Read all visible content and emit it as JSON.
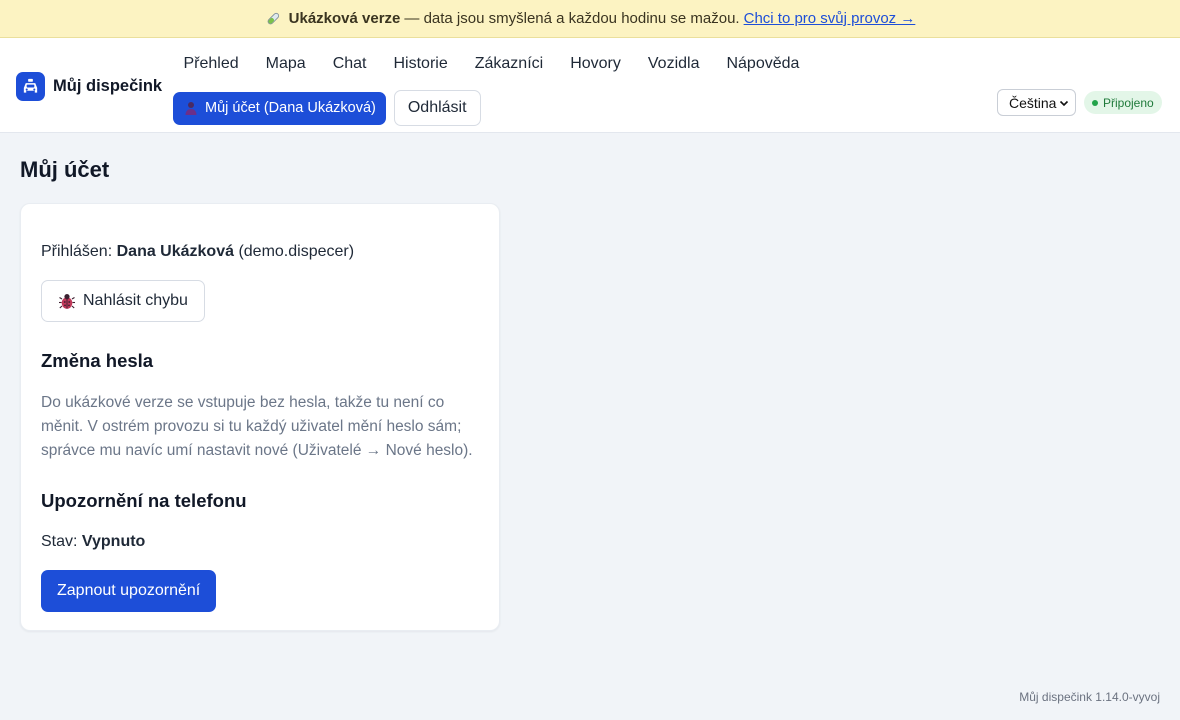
{
  "banner": {
    "icon": "test-tube-icon",
    "title": "Ukázková verze",
    "text": "— data jsou smyšlená a každou hodinu se mažou.",
    "link": "Chci to pro svůj provoz →"
  },
  "header": {
    "brand_icon": "taxi-icon",
    "brand_name": "Můj dispečink",
    "nav": [
      "Přehled",
      "Mapa",
      "Chat",
      "Historie",
      "Zákazníci",
      "Hovory",
      "Vozidla",
      "Nápověda"
    ],
    "account_button": "Můj účet (Dana Ukázková)",
    "logout_button": "Odhlásit",
    "language": "Čeština",
    "status": "Připojeno"
  },
  "page": {
    "title": "Můj účet",
    "logged_in_label": "Přihlášen:",
    "user_name": "Dana Ukázková",
    "username": "(demo.dispecer)",
    "report_bug_button": "Nahlásit chybu",
    "password_heading": "Změna hesla",
    "password_note": "Do ukázkové verze se vstupuje bez hesla, takže tu není co měnit. V ostrém provozu si tu každý uživatel mění heslo sám; správce mu navíc umí nastavit nové (Uživatelé → Nové heslo).",
    "notifications_heading": "Upozornění na telefonu",
    "state_label": "Stav:",
    "state_value": "Vypnuto",
    "enable_button": "Zapnout upozornění"
  },
  "footer": {
    "version": "Můj dispečink 1.14.0-vyvoj"
  },
  "colors": {
    "accent": "#1d4ed8",
    "banner_bg": "#fcf3c2",
    "status_bg": "#e3f6e8",
    "status_text": "#1f7a3a",
    "page_bg": "#f1f4f8"
  }
}
